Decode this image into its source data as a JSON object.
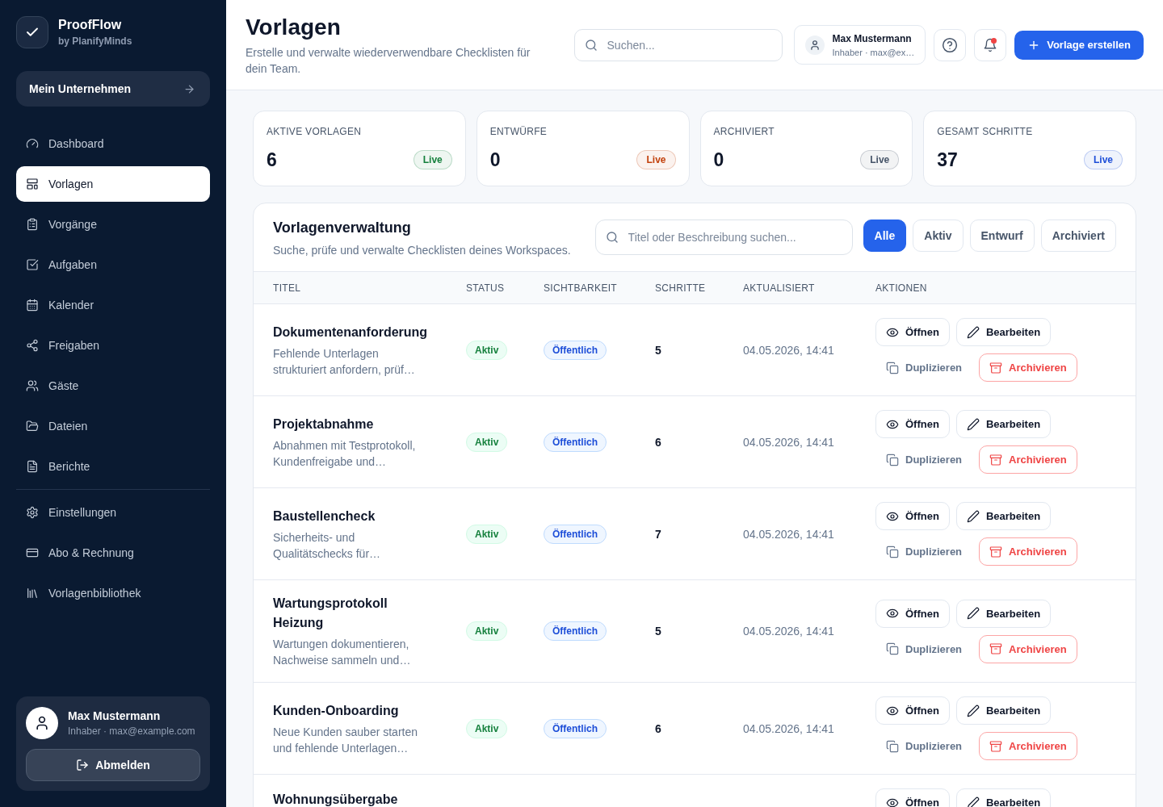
{
  "sidebar": {
    "brand": {
      "name": "ProofFlow",
      "byline": "by PlanifyMinds"
    },
    "workspace_button": {
      "label": "Mein Unternehmen"
    },
    "nav_sections": [
      {
        "items": [
          {
            "label": "Dashboard",
            "selected": false
          },
          {
            "label": "Vorlagen",
            "selected": true
          },
          {
            "label": "Vorgänge",
            "selected": false
          },
          {
            "label": "Aufgaben",
            "selected": false
          },
          {
            "label": "Kalender",
            "selected": false
          },
          {
            "label": "Freigaben",
            "selected": false
          },
          {
            "label": "Gäste",
            "selected": false
          },
          {
            "label": "Dateien",
            "selected": false
          },
          {
            "label": "Berichte",
            "selected": false
          }
        ]
      },
      {
        "items": [
          {
            "label": "Einstellungen",
            "selected": false
          },
          {
            "label": "Abo & Rechnung",
            "selected": false
          },
          {
            "label": "Vorlagenbibliothek",
            "selected": false
          }
        ]
      }
    ],
    "user": {
      "name": "Max Mustermann",
      "role": "Inhaber · max@example.com"
    },
    "logout_button": {
      "label": "Abmelden"
    }
  },
  "header": {
    "title": "Vorlagen",
    "subtitle": "Erstelle und verwalte wiederverwendbare Checklisten für dein Team.",
    "search": {
      "placeholder": "Suchen..."
    },
    "user": {
      "name": "Max Mustermann",
      "role": "Inhaber · max@ex…"
    },
    "notifications": {
      "unread": true
    },
    "create_button": {
      "label": "Vorlage erstellen"
    }
  },
  "stats": [
    {
      "label": "AKTIVE VORLAGEN",
      "value": "6",
      "badge": "Live",
      "color": "#15803d"
    },
    {
      "label": "ENTWÜRFE",
      "value": "0",
      "badge": "Live",
      "color": "#c2410c"
    },
    {
      "label": "ARCHIVIERT",
      "value": "0",
      "badge": "Live",
      "color": "#475569"
    },
    {
      "label": "GESAMT SCHRITTE",
      "value": "37",
      "badge": "Live",
      "color": "#1d4ed8"
    }
  ],
  "panel": {
    "title": "Vorlagenverwaltung",
    "subtitle": "Suche, prüfe und verwalte Checklisten deines Workspaces.",
    "search": {
      "placeholder": "Titel oder Beschreibung suchen..."
    },
    "filters": [
      {
        "label": "Alle",
        "selected": true
      },
      {
        "label": "Aktiv",
        "selected": false
      },
      {
        "label": "Entwurf",
        "selected": false
      },
      {
        "label": "Archiviert",
        "selected": false
      }
    ],
    "table": {
      "columns": [
        "TITEL",
        "STATUS",
        "SICHTBARKEIT",
        "SCHRITTE",
        "AKTUALISIERT",
        "AKTIONEN"
      ],
      "rows": [
        {
          "title": "Dokumentenanforderung",
          "description": "Fehlende Unterlagen strukturiert anfordern, prüf…",
          "status": "Aktiv",
          "visibility": "Öffentlich",
          "steps": "5",
          "updated": "04.05.2026, 14:41",
          "actions": [
            {
              "label": "Öffnen",
              "kind": "outline"
            },
            {
              "label": "Bearbeiten",
              "kind": "outline"
            },
            {
              "label": "Duplizieren",
              "kind": "ghost"
            },
            {
              "label": "Archivieren",
              "kind": "danger"
            }
          ]
        },
        {
          "title": "Projektabnahme",
          "description": "Abnahmen mit Testprotokoll, Kundenfreigabe und…",
          "status": "Aktiv",
          "visibility": "Öffentlich",
          "steps": "6",
          "updated": "04.05.2026, 14:41",
          "actions": [
            {
              "label": "Öffnen",
              "kind": "outline"
            },
            {
              "label": "Bearbeiten",
              "kind": "outline"
            },
            {
              "label": "Duplizieren",
              "kind": "ghost"
            },
            {
              "label": "Archivieren",
              "kind": "danger"
            }
          ]
        },
        {
          "title": "Baustellencheck",
          "description": "Sicherheits- und Qualitätschecks für…",
          "status": "Aktiv",
          "visibility": "Öffentlich",
          "steps": "7",
          "updated": "04.05.2026, 14:41",
          "actions": [
            {
              "label": "Öffnen",
              "kind": "outline"
            },
            {
              "label": "Bearbeiten",
              "kind": "outline"
            },
            {
              "label": "Duplizieren",
              "kind": "ghost"
            },
            {
              "label": "Archivieren",
              "kind": "danger"
            }
          ]
        },
        {
          "title": "Wartungsprotokoll Heizung",
          "description": "Wartungen dokumentieren, Nachweise sammeln und…",
          "status": "Aktiv",
          "visibility": "Öffentlich",
          "steps": "5",
          "updated": "04.05.2026, 14:41",
          "actions": [
            {
              "label": "Öffnen",
              "kind": "outline"
            },
            {
              "label": "Bearbeiten",
              "kind": "outline"
            },
            {
              "label": "Duplizieren",
              "kind": "ghost"
            },
            {
              "label": "Archivieren",
              "kind": "danger"
            }
          ]
        },
        {
          "title": "Kunden-Onboarding",
          "description": "Neue Kunden sauber starten und fehlende Unterlagen…",
          "status": "Aktiv",
          "visibility": "Öffentlich",
          "steps": "6",
          "updated": "04.05.2026, 14:41",
          "actions": [
            {
              "label": "Öffnen",
              "kind": "outline"
            },
            {
              "label": "Bearbeiten",
              "kind": "outline"
            },
            {
              "label": "Duplizieren",
              "kind": "ghost"
            },
            {
              "label": "Archivieren",
              "kind": "danger"
            }
          ]
        },
        {
          "title": "Wohnungsübergabe",
          "actions": [
            {
              "label": "Öffnen",
              "kind": "outline"
            },
            {
              "label": "Bearbeiten",
              "kind": "outline"
            }
          ]
        }
      ]
    }
  }
}
